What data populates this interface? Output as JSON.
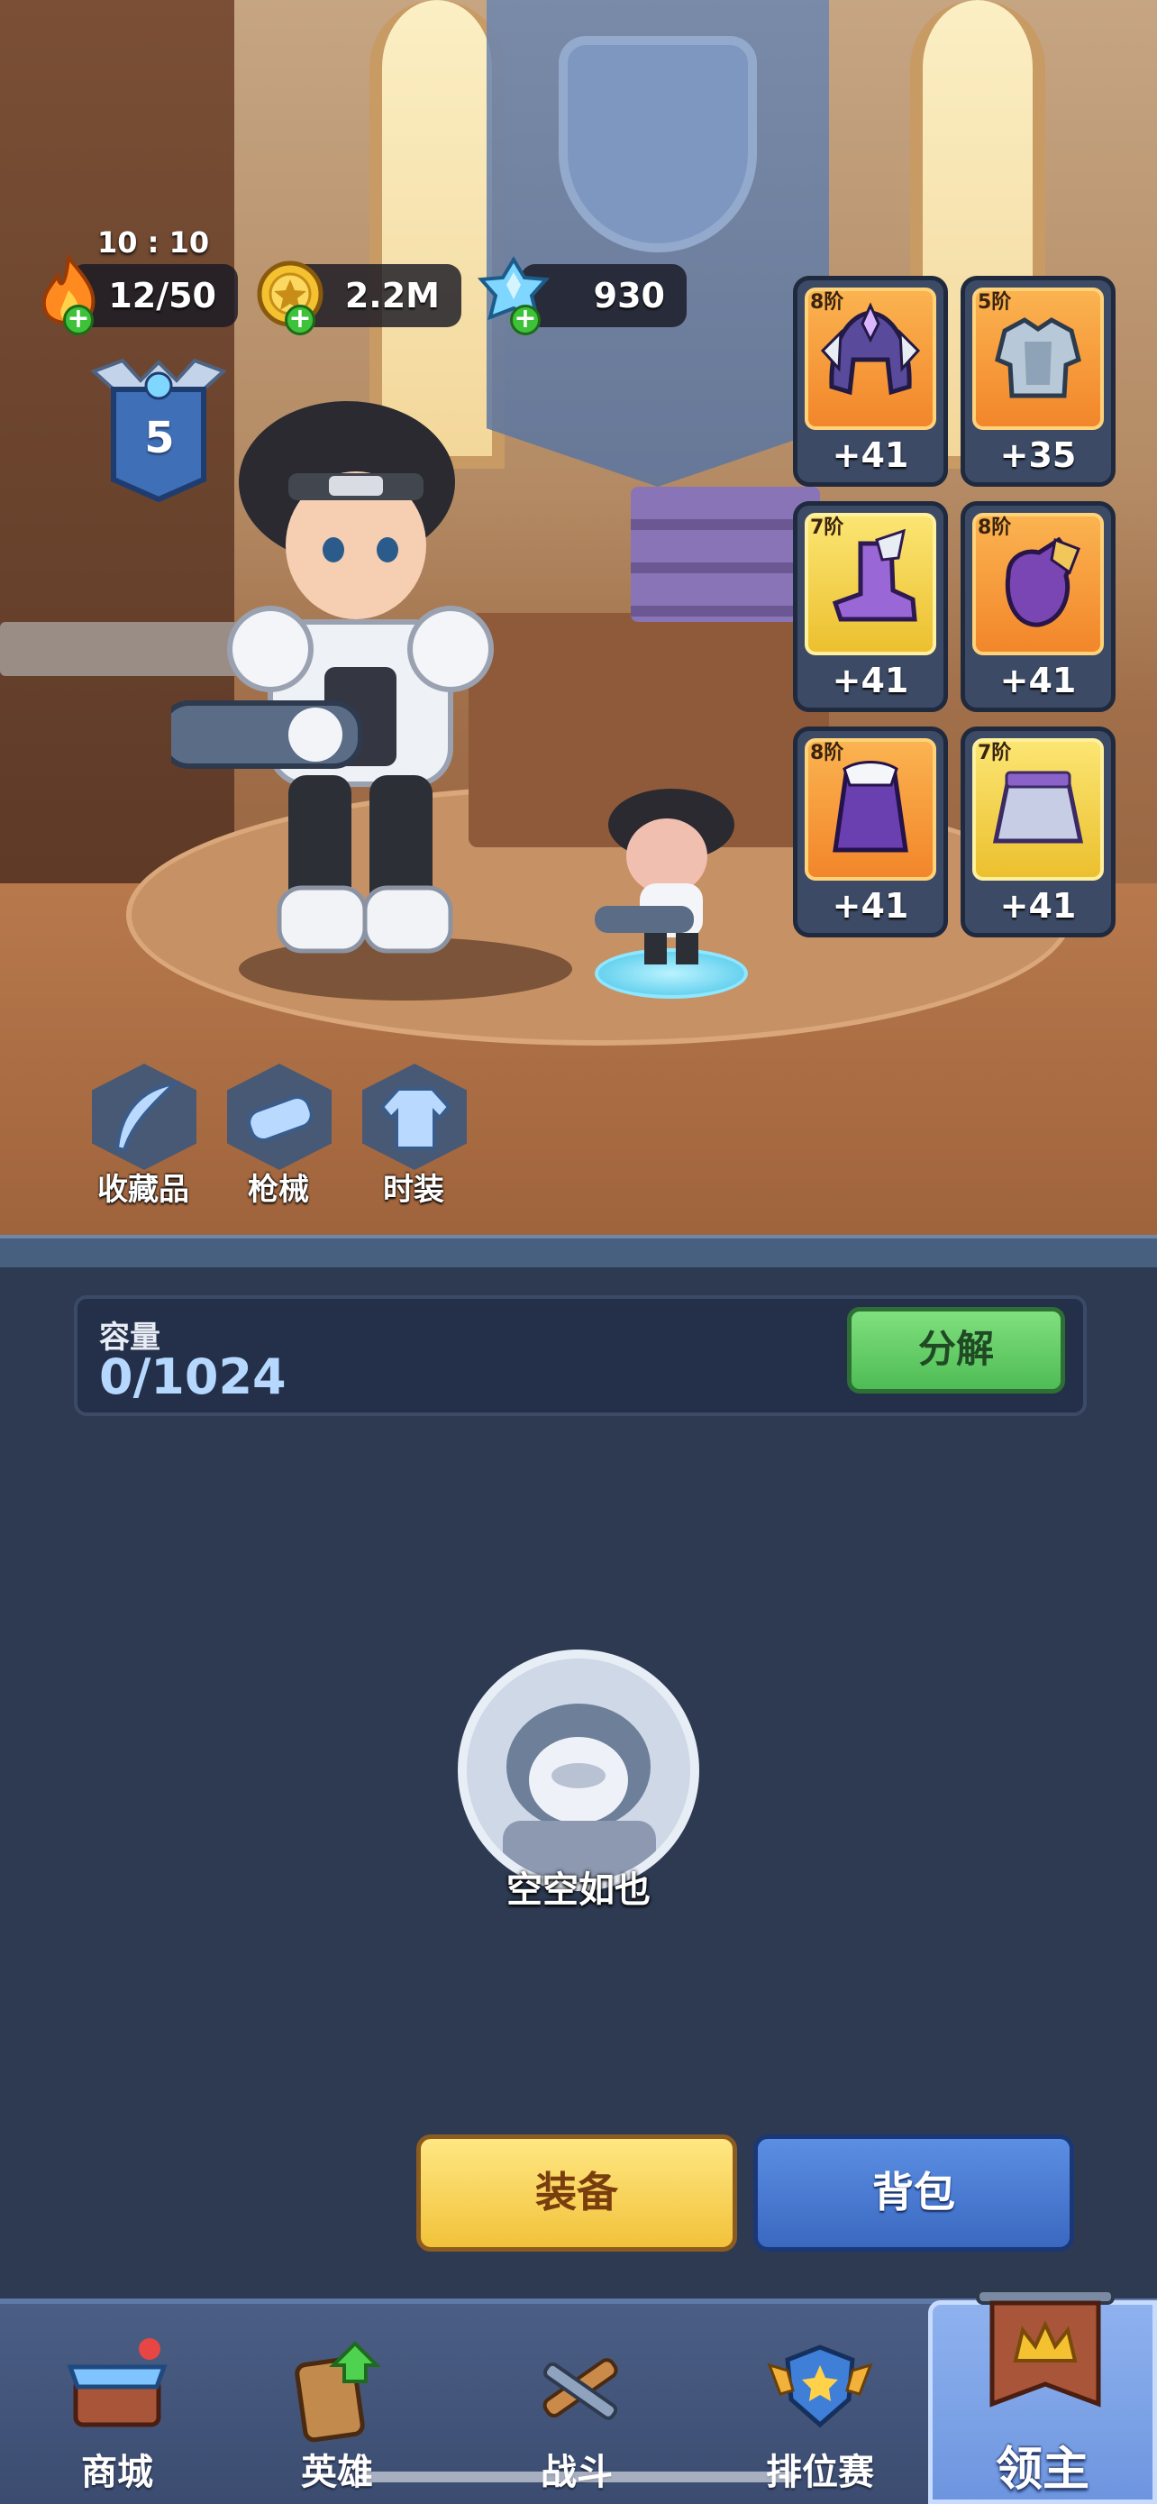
{
  "hud": {
    "time": "10 : 10",
    "energy": "12/50",
    "gold": "2.2M",
    "crystal": "930",
    "rank_level": "5"
  },
  "equipment": [
    {
      "tier": "8阶",
      "bonus": "+41",
      "item": "helmet-icon",
      "rarity": "orange"
    },
    {
      "tier": "5阶",
      "bonus": "+35",
      "item": "armor-icon",
      "rarity": "orange"
    },
    {
      "tier": "7阶",
      "bonus": "+41",
      "item": "boots-icon",
      "rarity": "yellow"
    },
    {
      "tier": "8阶",
      "bonus": "+41",
      "item": "gauntlet-icon",
      "rarity": "orange"
    },
    {
      "tier": "8阶",
      "bonus": "+41",
      "item": "cape-icon",
      "rarity": "orange"
    },
    {
      "tier": "7阶",
      "bonus": "+41",
      "item": "skirt-icon",
      "rarity": "yellow"
    }
  ],
  "quick_menu": {
    "collection": "收藏品",
    "guns": "枪械",
    "fashion": "时装"
  },
  "inventory": {
    "capacity_label": "容量",
    "capacity_value": "0/1024",
    "decompose_label": "分解",
    "empty_text": "空空如也"
  },
  "actions": {
    "equip_label": "装备",
    "bag_label": "背包"
  },
  "nav": {
    "shop": "商城",
    "heroes": "英雄",
    "battle": "战斗",
    "ranked": "排位赛",
    "lord": "领主"
  },
  "colors": {
    "panel_bg": "#2d3a52",
    "decompose_green": "#4fbc55",
    "equip_yellow": "#f2c23a",
    "bag_blue": "#3b68c0",
    "rarity_orange": "#f2862a",
    "rarity_yellow": "#ecc02f"
  }
}
